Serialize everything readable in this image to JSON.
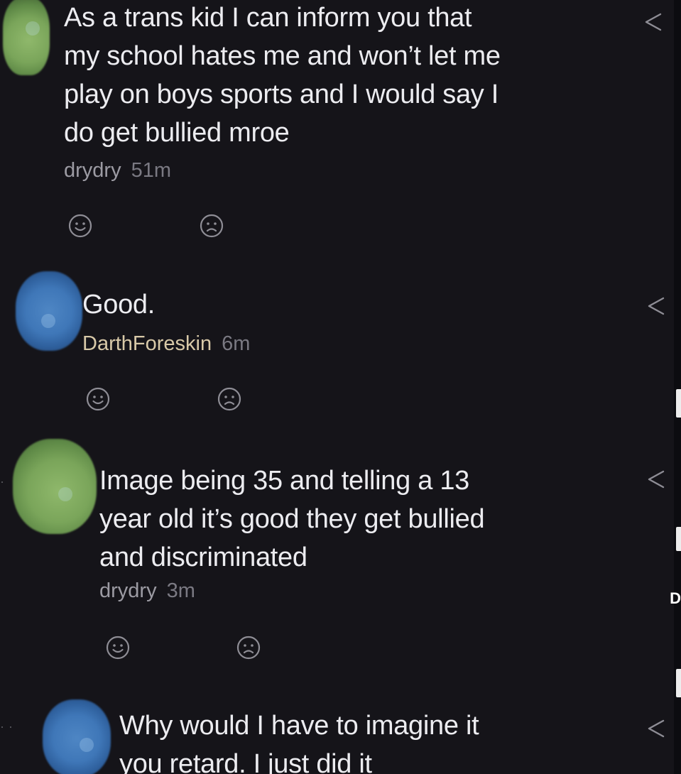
{
  "comments": [
    {
      "text": "As a trans kid I can inform you that\nmy school hates me and won’t let me\nplay on boys sports and I would say I\ndo get bullied mroe",
      "user": "drydry",
      "time": "51m",
      "avatar_icon": "green-avatar-icon"
    },
    {
      "text": "Good.",
      "user": "DarthForeskin",
      "time": "6m",
      "avatar_icon": "blue-avatar-icon"
    },
    {
      "text": "Image being 35 and telling a 13\nyear old it’s good they get bullied\nand discriminated",
      "user": "drydry",
      "time": "3m",
      "avatar_icon": "green-avatar-icon"
    },
    {
      "text": "Why would I have to imagine it\nyou retard. I just did it",
      "avatar_icon": "blue-avatar-icon"
    }
  ],
  "edge": {
    "letter": "D"
  },
  "colors": {
    "background": "#151419",
    "text": "#ececf0",
    "username": "#9c9ba3",
    "username_accent": "#d8c9a8",
    "timestamp": "#7a7982",
    "icon": "#8e8d95"
  },
  "icons": [
    "smile-icon",
    "sad-icon",
    "reply-icon"
  ]
}
